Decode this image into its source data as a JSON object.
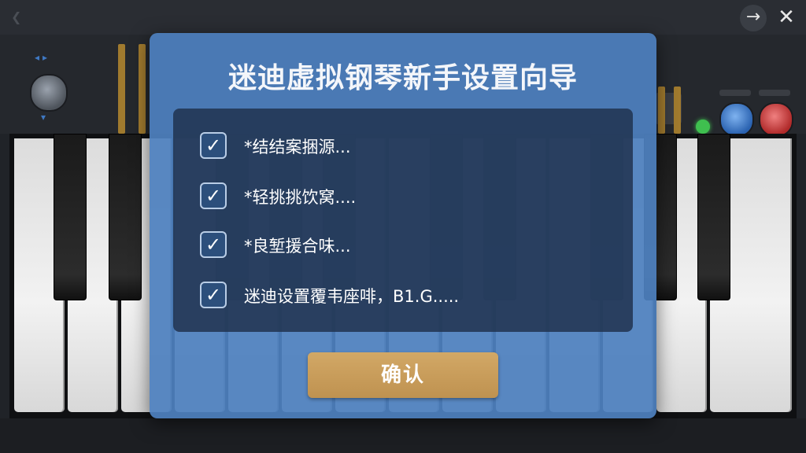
{
  "window": {
    "next_glyph": "→",
    "close_glyph": "✕"
  },
  "dialog": {
    "title": "迷迪虚拟钢琴新手设置向导",
    "options": [
      {
        "label": "*结结案捆源...",
        "checked": true
      },
      {
        "label": "*轻挑挑饮窝....",
        "checked": true
      },
      {
        "label": "*良堑援合味...",
        "checked": true
      },
      {
        "label": "迷迪设置覆韦座啡，B1.G.....",
        "checked": true
      }
    ],
    "check_glyph": "✓",
    "confirm_label": "确认"
  },
  "colors": {
    "dialog_bg": "#4e80be",
    "panel_bg": "#1e304a",
    "confirm_bg": "#c99c5a",
    "led_green": "#3fbf4f"
  }
}
